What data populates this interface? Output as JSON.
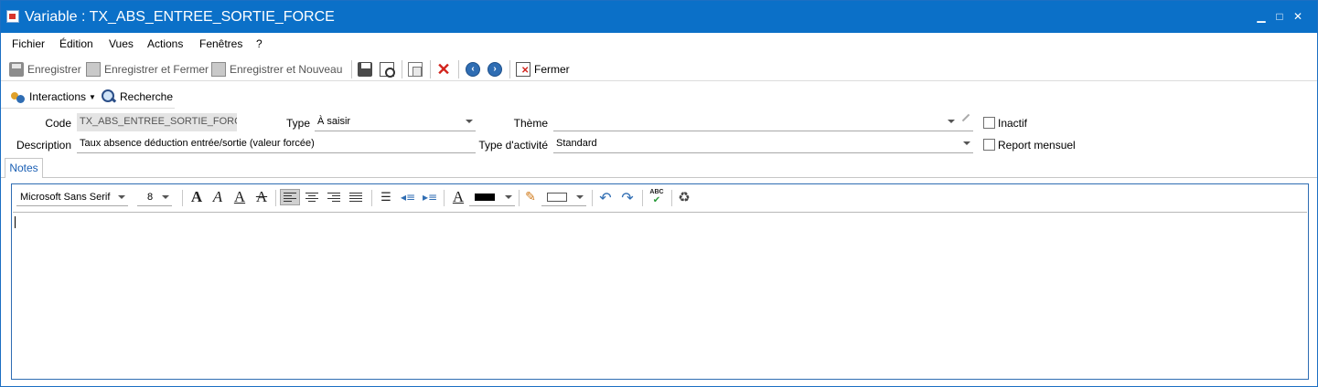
{
  "window": {
    "title": "Variable : TX_ABS_ENTREE_SORTIE_FORCE",
    "controls": {
      "minimize": "▁",
      "maximize": "□",
      "close": "✕"
    }
  },
  "menu": {
    "items": [
      "Fichier",
      "Édition",
      "Vues",
      "Actions",
      "Fenêtres",
      "?"
    ]
  },
  "toolbar": {
    "save": "Enregistrer",
    "save_close": "Enregistrer et Fermer",
    "save_new": "Enregistrer et Nouveau",
    "close": "Fermer"
  },
  "toolbar2": {
    "interactions": "Interactions",
    "search": "Recherche"
  },
  "form": {
    "code_label": "Code",
    "code_value": "TX_ABS_ENTREE_SORTIE_FORCE",
    "type_label": "Type",
    "type_value": "À saisir",
    "theme_label": "Thème",
    "theme_value": "",
    "inactive_label": "Inactif",
    "inactive_checked": false,
    "description_label": "Description",
    "description_value": "Taux absence déduction entrée/sortie (valeur forcée)",
    "activity_type_label": "Type d'activité",
    "activity_type_value": "Standard",
    "monthly_report_label": "Report mensuel",
    "monthly_report_checked": false
  },
  "tabs": {
    "notes": "Notes"
  },
  "editor": {
    "font_name": "Microsoft Sans Serif",
    "font_size": "8",
    "bold": "A",
    "italic": "A",
    "underline": "A",
    "strike": "A",
    "spellcheck_label": "ABC",
    "text_color": "#000000",
    "content": ""
  }
}
